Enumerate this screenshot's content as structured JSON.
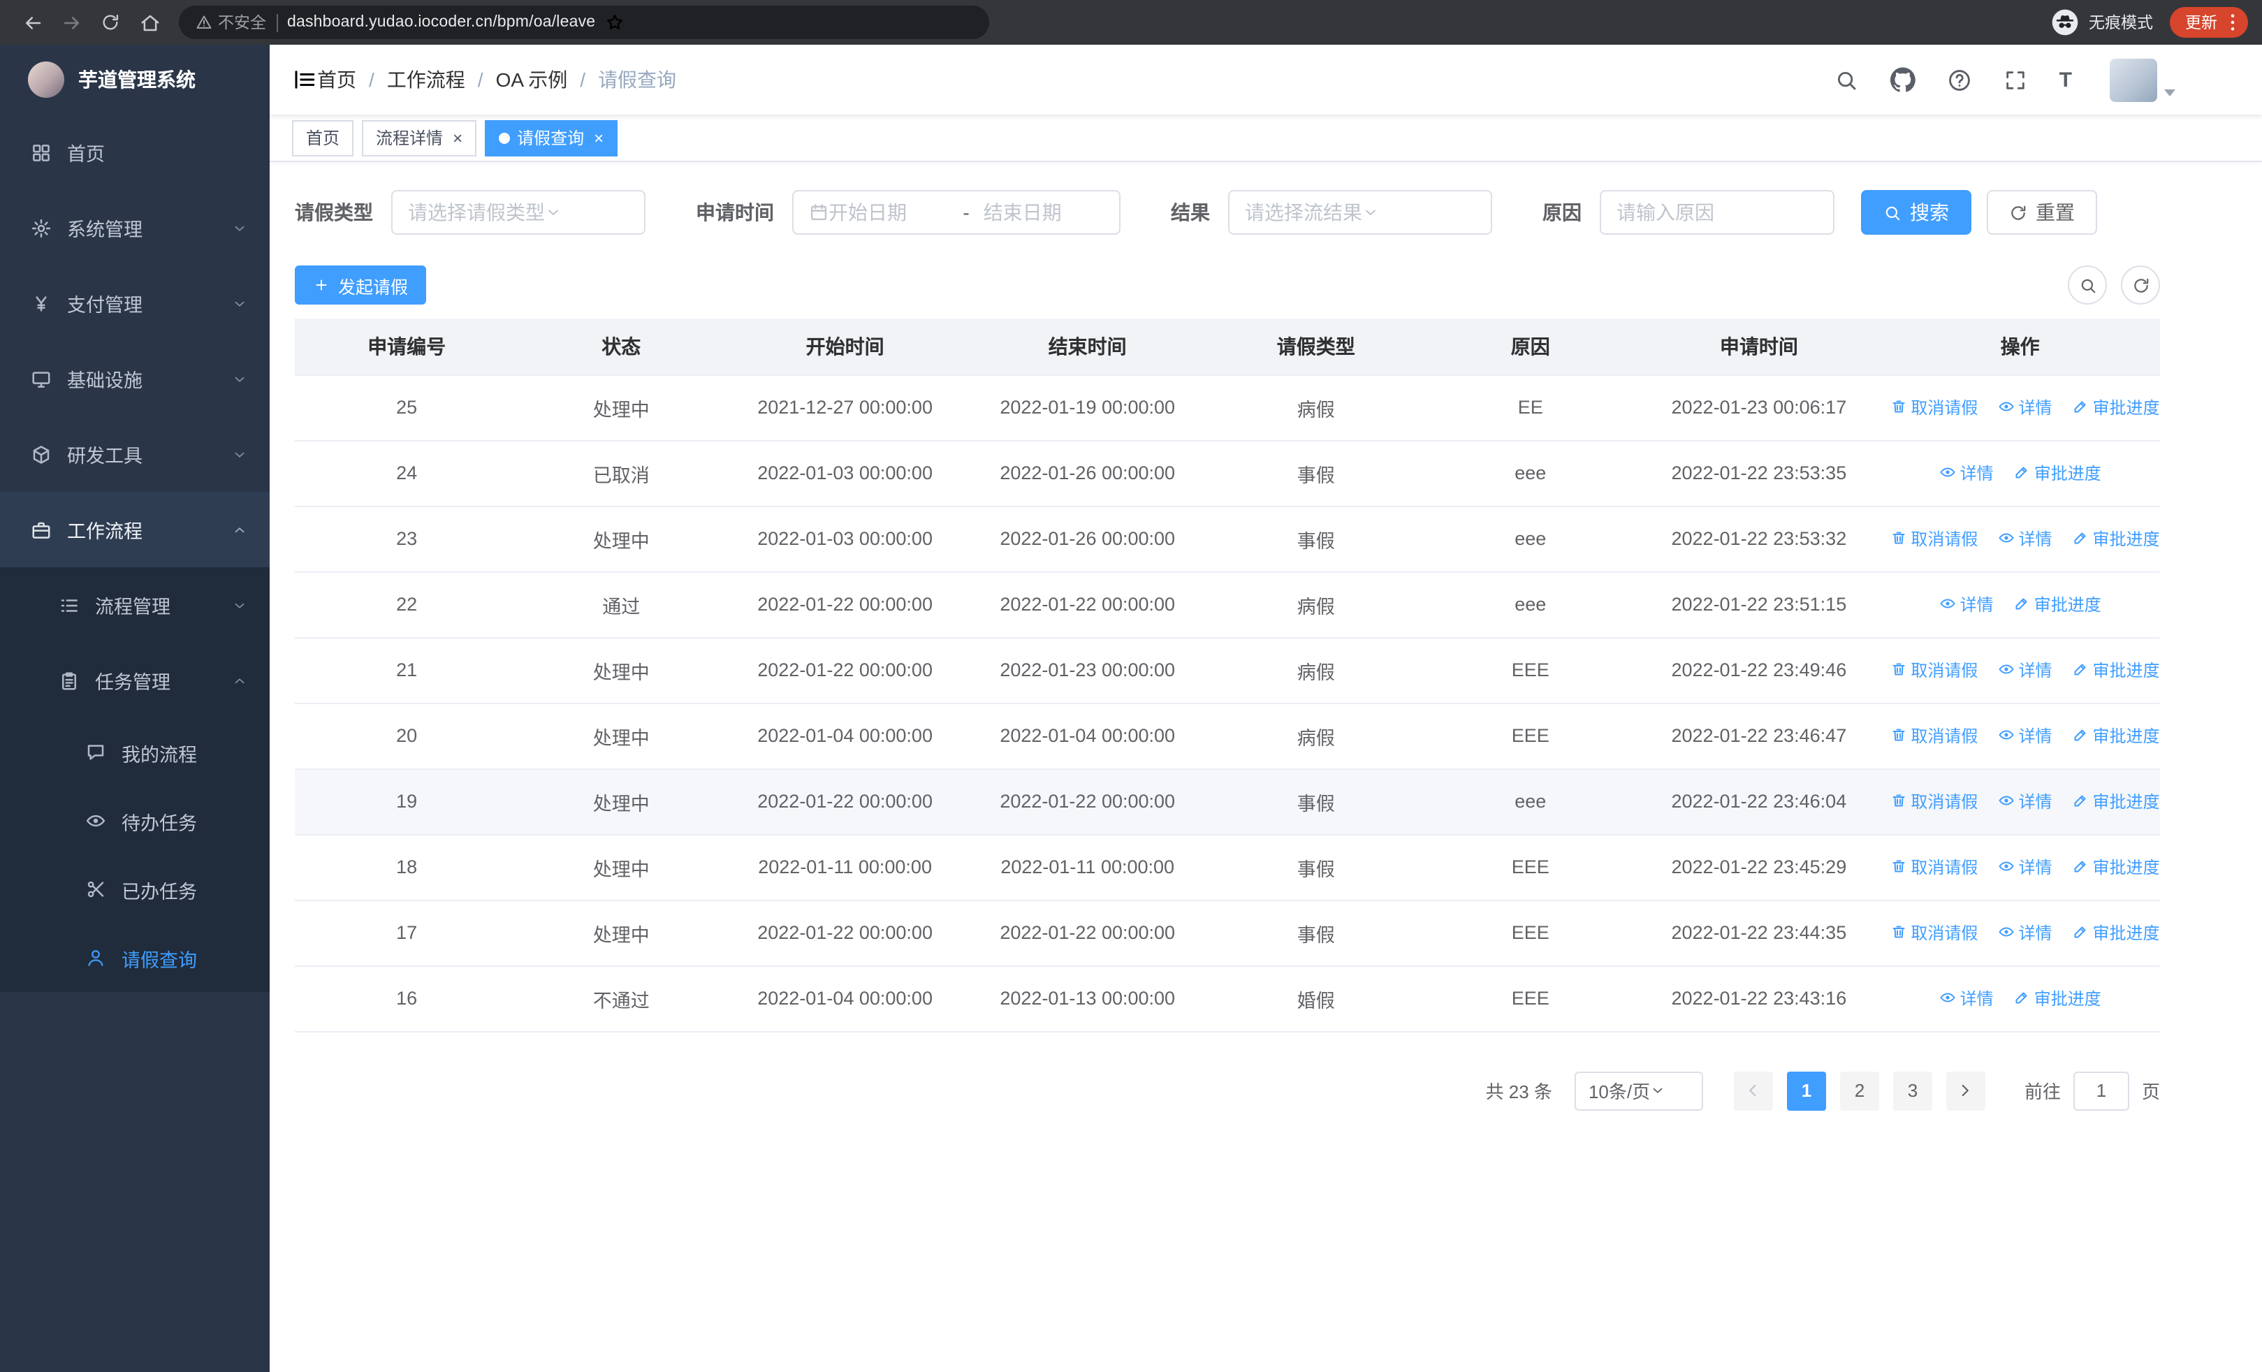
{
  "browser": {
    "security_warning": "不安全",
    "url": "dashboard.yudao.iocoder.cn/bpm/oa/leave",
    "incognito_label": "无痕模式",
    "update_label": "更新"
  },
  "sidebar": {
    "logo_title": "芋道管理系统",
    "items": [
      {
        "label": "首页",
        "icon": "dashboard-icon",
        "level": 1,
        "expandable": false
      },
      {
        "label": "系统管理",
        "icon": "gear-icon",
        "level": 1,
        "expandable": true,
        "expanded": false
      },
      {
        "label": "支付管理",
        "icon": "yen-icon",
        "level": 1,
        "expandable": true,
        "expanded": false
      },
      {
        "label": "基础设施",
        "icon": "monitor-icon",
        "level": 1,
        "expandable": true,
        "expanded": false
      },
      {
        "label": "研发工具",
        "icon": "cube-icon",
        "level": 1,
        "expandable": true,
        "expanded": false
      },
      {
        "label": "工作流程",
        "icon": "briefcase-icon",
        "level": 1,
        "expandable": true,
        "expanded": true
      },
      {
        "label": "流程管理",
        "icon": "list-icon",
        "level": 2,
        "expandable": true,
        "expanded": false
      },
      {
        "label": "任务管理",
        "icon": "clipboard-icon",
        "level": 2,
        "expandable": true,
        "expanded": true
      },
      {
        "label": "我的流程",
        "icon": "chat-icon",
        "level": 3
      },
      {
        "label": "待办任务",
        "icon": "eye-icon",
        "level": 3
      },
      {
        "label": "已办任务",
        "icon": "scissors-icon",
        "level": 3
      },
      {
        "label": "请假查询",
        "icon": "user-icon",
        "level": 3,
        "active": true
      }
    ]
  },
  "header": {
    "breadcrumb": [
      "首页",
      "工作流程",
      "OA 示例",
      "请假查询"
    ]
  },
  "tabs": [
    {
      "label": "首页",
      "closable": false,
      "active": false
    },
    {
      "label": "流程详情",
      "closable": true,
      "active": false
    },
    {
      "label": "请假查询",
      "closable": true,
      "active": true
    }
  ],
  "filters": {
    "leave_type_label": "请假类型",
    "leave_type_placeholder": "请选择请假类型",
    "apply_time_label": "申请时间",
    "start_date_placeholder": "开始日期",
    "date_separator": "-",
    "end_date_placeholder": "结束日期",
    "result_label": "结果",
    "result_placeholder": "请选择流结果",
    "reason_label": "原因",
    "reason_placeholder": "请输入原因",
    "search_button": "搜索",
    "reset_button": "重置"
  },
  "toolbar": {
    "create_button": "发起请假"
  },
  "table": {
    "columns": [
      "申请编号",
      "状态",
      "开始时间",
      "结束时间",
      "请假类型",
      "原因",
      "申请时间",
      "操作"
    ],
    "op_defs": {
      "cancel": {
        "label": "取消请假",
        "icon": "delete-icon"
      },
      "detail": {
        "label": "详情",
        "icon": "eye-icon"
      },
      "progress": {
        "label": "审批进度",
        "icon": "edit-icon"
      }
    },
    "rows": [
      {
        "id": "25",
        "status": "处理中",
        "start": "2021-12-27 00:00:00",
        "end": "2022-01-19 00:00:00",
        "type": "病假",
        "reason": "EE",
        "apply_time": "2022-01-23 00:06:17",
        "ops": [
          "cancel",
          "detail",
          "progress"
        ]
      },
      {
        "id": "24",
        "status": "已取消",
        "start": "2022-01-03 00:00:00",
        "end": "2022-01-26 00:00:00",
        "type": "事假",
        "reason": "eee",
        "apply_time": "2022-01-22 23:53:35",
        "ops": [
          "detail",
          "progress"
        ]
      },
      {
        "id": "23",
        "status": "处理中",
        "start": "2022-01-03 00:00:00",
        "end": "2022-01-26 00:00:00",
        "type": "事假",
        "reason": "eee",
        "apply_time": "2022-01-22 23:53:32",
        "ops": [
          "cancel",
          "detail",
          "progress"
        ]
      },
      {
        "id": "22",
        "status": "通过",
        "start": "2022-01-22 00:00:00",
        "end": "2022-01-22 00:00:00",
        "type": "病假",
        "reason": "eee",
        "apply_time": "2022-01-22 23:51:15",
        "ops": [
          "detail",
          "progress"
        ]
      },
      {
        "id": "21",
        "status": "处理中",
        "start": "2022-01-22 00:00:00",
        "end": "2022-01-23 00:00:00",
        "type": "病假",
        "reason": "EEE",
        "apply_time": "2022-01-22 23:49:46",
        "ops": [
          "cancel",
          "detail",
          "progress"
        ]
      },
      {
        "id": "20",
        "status": "处理中",
        "start": "2022-01-04 00:00:00",
        "end": "2022-01-04 00:00:00",
        "type": "病假",
        "reason": "EEE",
        "apply_time": "2022-01-22 23:46:47",
        "ops": [
          "cancel",
          "detail",
          "progress"
        ]
      },
      {
        "id": "19",
        "status": "处理中",
        "start": "2022-01-22 00:00:00",
        "end": "2022-01-22 00:00:00",
        "type": "事假",
        "reason": "eee",
        "apply_time": "2022-01-22 23:46:04",
        "ops": [
          "cancel",
          "detail",
          "progress"
        ],
        "highlight": true
      },
      {
        "id": "18",
        "status": "处理中",
        "start": "2022-01-11 00:00:00",
        "end": "2022-01-11 00:00:00",
        "type": "事假",
        "reason": "EEE",
        "apply_time": "2022-01-22 23:45:29",
        "ops": [
          "cancel",
          "detail",
          "progress"
        ]
      },
      {
        "id": "17",
        "status": "处理中",
        "start": "2022-01-22 00:00:00",
        "end": "2022-01-22 00:00:00",
        "type": "事假",
        "reason": "EEE",
        "apply_time": "2022-01-22 23:44:35",
        "ops": [
          "cancel",
          "detail",
          "progress"
        ]
      },
      {
        "id": "16",
        "status": "不通过",
        "start": "2022-01-04 00:00:00",
        "end": "2022-01-13 00:00:00",
        "type": "婚假",
        "reason": "EEE",
        "apply_time": "2022-01-22 23:43:16",
        "ops": [
          "detail",
          "progress"
        ]
      }
    ]
  },
  "pagination": {
    "total_text": "共 23 条",
    "page_size": "10条/页",
    "pages": [
      "1",
      "2",
      "3"
    ],
    "active_page": "1",
    "goto_label": "前往",
    "goto_value": "1",
    "goto_suffix": "页"
  },
  "colors": {
    "accent": "#409eff",
    "sidebar_bg": "#2a3648",
    "submenu_bg": "#202b3b",
    "update_pill": "#d6452c"
  }
}
